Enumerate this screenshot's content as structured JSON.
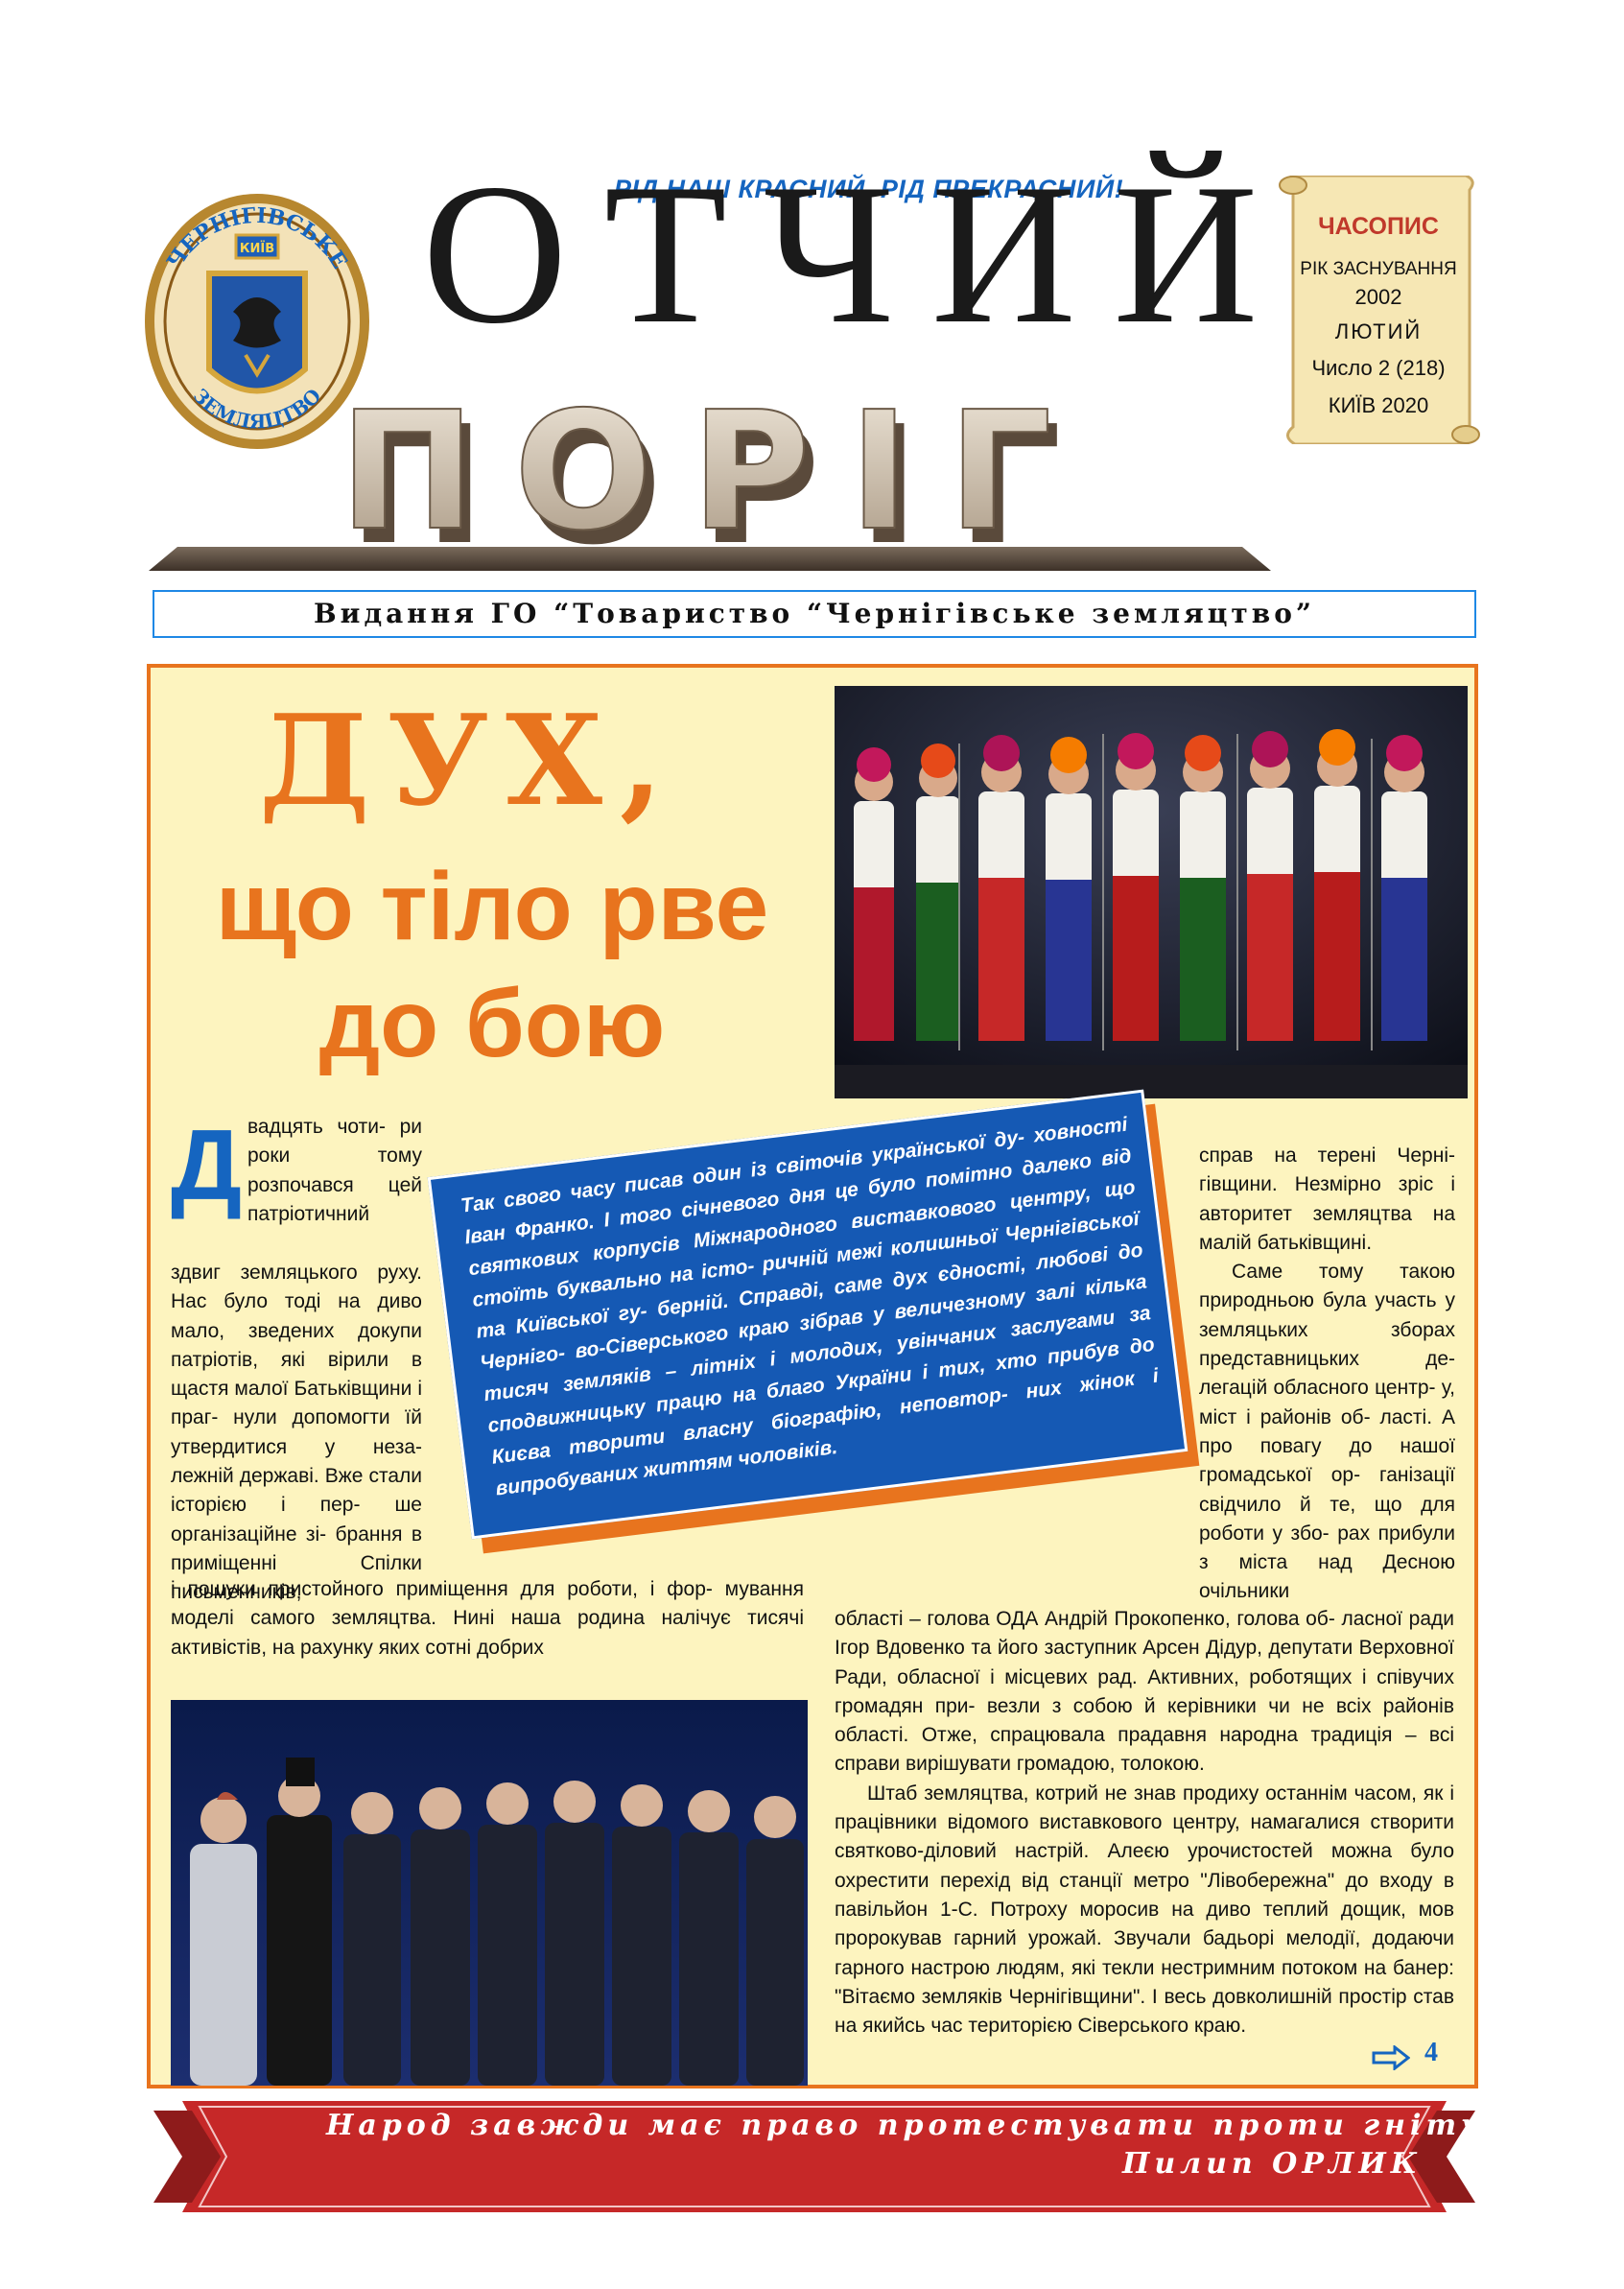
{
  "masthead": {
    "emblem_text_top": "ЧЕРНІГІВСЬКЕ",
    "emblem_text_bottom": "ЗЕМЛЯЦТВО",
    "emblem_city": "КИЇВ",
    "slogan": "РІД НАШ КРАСНИЙ, РІД ПРЕКРАСНИЙ!",
    "title_top": "ОТЧИЙ",
    "title_bottom": "ПОРІГ",
    "publication_type": "ЧАСОПИС",
    "founded_label": "РІК ЗАСНУВАННЯ",
    "founded_year": "2002",
    "month": "ЛЮТИЙ",
    "issue": "Число 2 (218)",
    "city_year": "КИЇВ 2020",
    "publisher": "Видання ГО “Товариство “Чернігівське земляцтво”"
  },
  "article": {
    "headline_1": "ДУХ,",
    "headline_2": "що тіло рве",
    "headline_3": "до бою",
    "dropcap": "Д",
    "col1_a": "вадцять чоти- ри роки тому розпочався цей патріотичний",
    "col1_b": "здвиг земляцького руху. Нас було тоді на диво мало, зведених докупи патріотів, які вірили в щастя малої Батьківщини і праг- нули допомогти їй утвердитися у неза- лежній державі. Вже стали історією і пер- ше організаційне зі- брання в приміщенні Спілки письменників,",
    "col1_c": "і пошуки пристойного приміщення для роботи, і фор- мування моделі самого земляцтва. Нині наша родина налічує тисячі активістів, на рахунку яких сотні добрих",
    "quote": "Так свого часу писав один із світочів української ду- ховності Іван Франко. І того січневого дня це було помітно далеко від святкових корпусів Міжнародного виставкового центру, що стоїть буквально на істо- ричній межі колишньої Чернігівської та Київської гу- берній. Справді, саме дух єдності, любові до Чернігo- во-Сіверського краю зібрав у величезному залі кілька тисяч земляків – літніх і молодих, увінчаних заслугами за сподвижницьку працю на благо України і тих, хто прибув до Києва творити власну біографію, неповтор- них жінок і випробуваних життям чоловіків.",
    "col3_p1": "справ на терені Черні- гівщини. Незмірно зріс і авторитет земляцтва на малій батьківщині.",
    "col3_p2": "Саме тому такою природньою була участь у земляцьких зборах представницьких де- легацій обласного центр- у, міст і районів об- ласті. А про повагу до нашої громадської ор- ганізації свідчило й те, що для роботи у збо- рах прибули з міста над Десною очільники",
    "col2_p1": "області – голова ОДА Андрій Прокопенко, голова об- ласної ради Ігор Вдовенко та його заступник Арсен Дідур, депутати Верховної Ради, обласної і місцевих рад. Активних, роботящих і співучих громадян при- везли з собою й керівники чи не всіх районів області. Отже, спрацювала прадавня народна традиція – всі справи вирішувати громадою, толокою.",
    "col2_p2": "Штаб земляцтва, котрий не знав продиху останнім часом, як і працівники відомого виставкового центру, намагалися створити святково-діловий настрій. Алеєю урочистостей можна було охрестити перехід від станції метро \"Лівобережна\" до входу в павільйон 1-С. Потроху моросив на диво теплий дощик, мов пророкував гарний урожай. Звучали бадьорі мелодії, додаючи гарного настрою людям, які текли нестримним потоком на банер: \"Вітаємо земляків Чернігівщини\". І весь довколишній простір став на якийсь час територією Сіверського краю.",
    "continued_page": "4"
  },
  "footer": {
    "motto": "Народ завжди має право протестувати проти гніту.",
    "author": "Пилип ОРЛИК"
  },
  "colors": {
    "accent_orange": "#e8741e",
    "accent_blue": "#1565c0",
    "panel_bg": "#fdf4bf",
    "ribbon_red": "#c62828"
  }
}
